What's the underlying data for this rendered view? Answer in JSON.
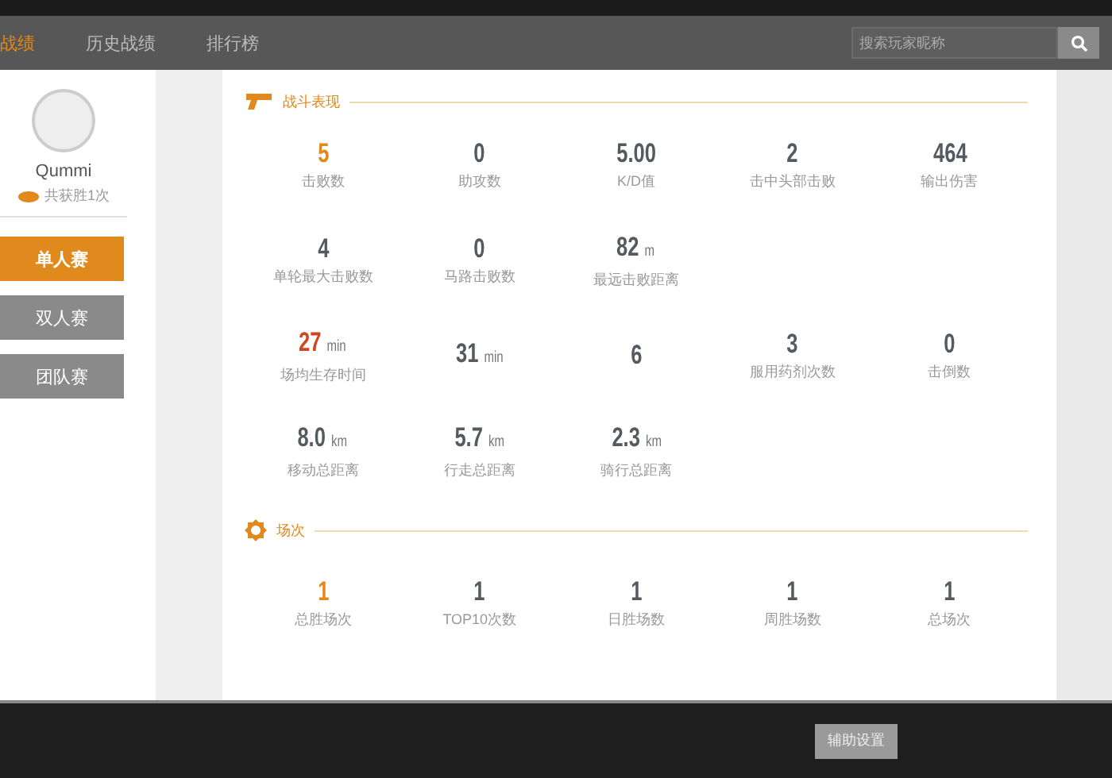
{
  "nav": {
    "tabs": [
      {
        "label": "战绩",
        "selected": true
      },
      {
        "label": "历史战绩",
        "selected": false
      },
      {
        "label": "排行榜",
        "selected": false
      }
    ],
    "search": {
      "placeholder": "搜索玩家昵称"
    }
  },
  "profile": {
    "name": "Qummi",
    "wins": "共获胜1次"
  },
  "modes": [
    {
      "label": "单人赛",
      "selected": true
    },
    {
      "label": "双人赛",
      "selected": false
    },
    {
      "label": "团队赛",
      "selected": false
    }
  ],
  "sections": [
    {
      "kind": "combat",
      "title": "战斗表现",
      "rows": [
        [
          {
            "value": "5",
            "label": "击败数",
            "color": "#e0891c"
          },
          {
            "value": "0",
            "label": "助攻数",
            "color": "#555a60"
          },
          {
            "value": "5.00",
            "label": "K/D值",
            "color": "#555a60"
          },
          {
            "value": "2",
            "label": "击中头部击败",
            "color": "#555a60"
          },
          {
            "value": "464",
            "label": "输出伤害",
            "color": "#555a60"
          }
        ],
        [
          {
            "value": "4",
            "label": "单轮最大击败数",
            "color": "#555a60"
          },
          {
            "value": "0",
            "label": "马路击败数",
            "color": "#555a60"
          },
          {
            "value": "82",
            "unit": "m",
            "label": "最远击败距离",
            "color": "#555a60"
          }
        ],
        [
          {
            "value": "27",
            "unit": "min",
            "label": "场均生存时间",
            "color": "#d2461e"
          },
          {
            "value": "31",
            "unit": "min",
            "color": "#555a60"
          },
          {
            "value": "6",
            "color": "#555a60"
          },
          {
            "value": "3",
            "label": "服用药剂次数",
            "color": "#555a60"
          },
          {
            "value": "0",
            "label": "击倒数",
            "color": "#555a60"
          }
        ],
        [
          {
            "value": "8.0",
            "unit": "km",
            "label": "移动总距离",
            "color": "#555a60"
          },
          {
            "value": "5.7",
            "unit": "km",
            "label": "行走总距离",
            "color": "#555a60"
          },
          {
            "value": "2.3",
            "unit": "km",
            "label": "骑行总距离",
            "color": "#555a60"
          }
        ]
      ]
    },
    {
      "kind": "matches",
      "title": "场次",
      "rows": [
        [
          {
            "value": "1",
            "label": "总胜场次",
            "color": "#e0891c"
          },
          {
            "value": "1",
            "label": "TOP10次数",
            "color": "#555a60"
          },
          {
            "value": "1",
            "label": "日胜场数",
            "color": "#555a60"
          },
          {
            "value": "1",
            "label": "周胜场数",
            "color": "#555a60"
          },
          {
            "value": "1",
            "label": "总场次",
            "color": "#555a60"
          }
        ]
      ]
    }
  ],
  "footer": {
    "button": "辅助设置"
  }
}
